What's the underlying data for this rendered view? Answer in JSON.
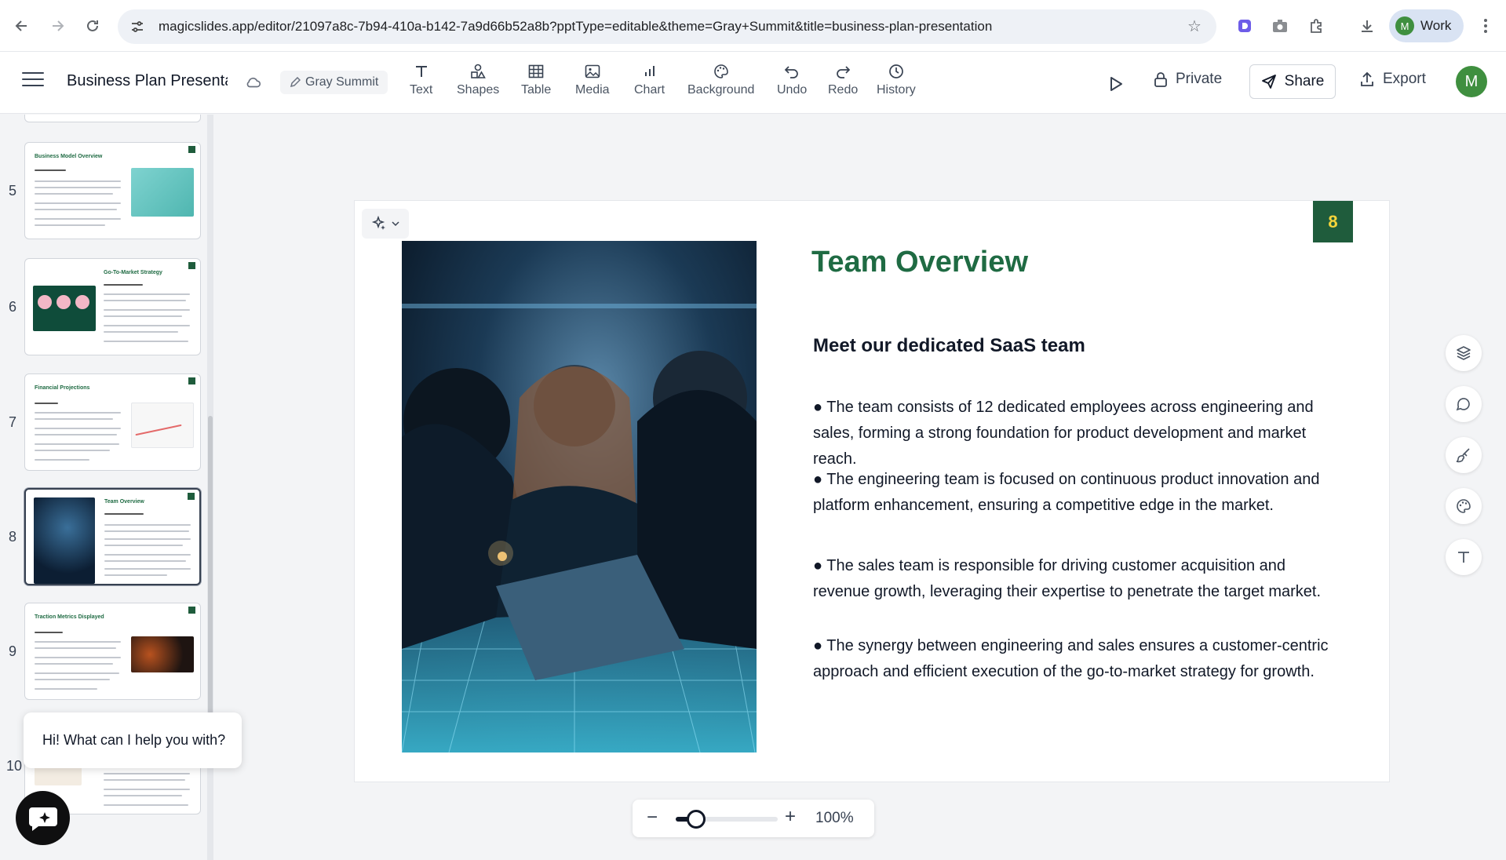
{
  "browser": {
    "url": "magicslides.app/editor/21097a8c-7b94-410a-b142-7a9d66b52a8b?pptType=editable&theme=Gray+Summit&title=business-plan-presentation",
    "profile_label": "Work",
    "profile_initial": "M"
  },
  "app": {
    "doc_title": "Business Plan Presentati",
    "theme_label": "Gray Summit",
    "tools": [
      {
        "label": "Text",
        "icon": "text-icon"
      },
      {
        "label": "Shapes",
        "icon": "shapes-icon"
      },
      {
        "label": "Table",
        "icon": "table-icon"
      },
      {
        "label": "Media",
        "icon": "media-icon"
      },
      {
        "label": "Chart",
        "icon": "chart-icon"
      },
      {
        "label": "Background",
        "icon": "palette-icon"
      },
      {
        "label": "Undo",
        "icon": "undo-icon"
      },
      {
        "label": "Redo",
        "icon": "redo-icon"
      },
      {
        "label": "History",
        "icon": "history-icon"
      }
    ],
    "private_label": "Private",
    "share_label": "Share",
    "export_label": "Export",
    "avatar_initial": "M"
  },
  "sidebar": {
    "slides": [
      {
        "num": "5",
        "title": "Business Model Overview"
      },
      {
        "num": "6",
        "title": "Go-To-Market Strategy"
      },
      {
        "num": "7",
        "title": "Financial Projections"
      },
      {
        "num": "8",
        "title": "Team Overview"
      },
      {
        "num": "9",
        "title": "Traction Metrics Displayed"
      },
      {
        "num": "10",
        "title": ""
      }
    ]
  },
  "chat": {
    "greeting": "Hi! What can I help you with?"
  },
  "slide": {
    "page_number": "8",
    "title": "Team Overview",
    "subtitle": "Meet our dedicated SaaS team",
    "bullets": [
      "● The team consists of 12 dedicated employees across engineering and sales, forming a strong foundation for product development and market reach.",
      "● The engineering team is focused on continuous product innovation and platform enhancement, ensuring a competitive edge in the market.",
      "● The sales team is responsible for driving customer acquisition and revenue growth, leveraging their expertise to penetrate the target market.",
      "● The synergy between engineering and sales ensures a customer-centric approach and efficient execution of the go-to-market strategy for growth."
    ],
    "title_color": "#1f6b43",
    "badge_color": "#1f5c3c",
    "badge_text_color": "#f5d43b"
  },
  "zoom": {
    "label": "100%",
    "level": 0.2
  }
}
